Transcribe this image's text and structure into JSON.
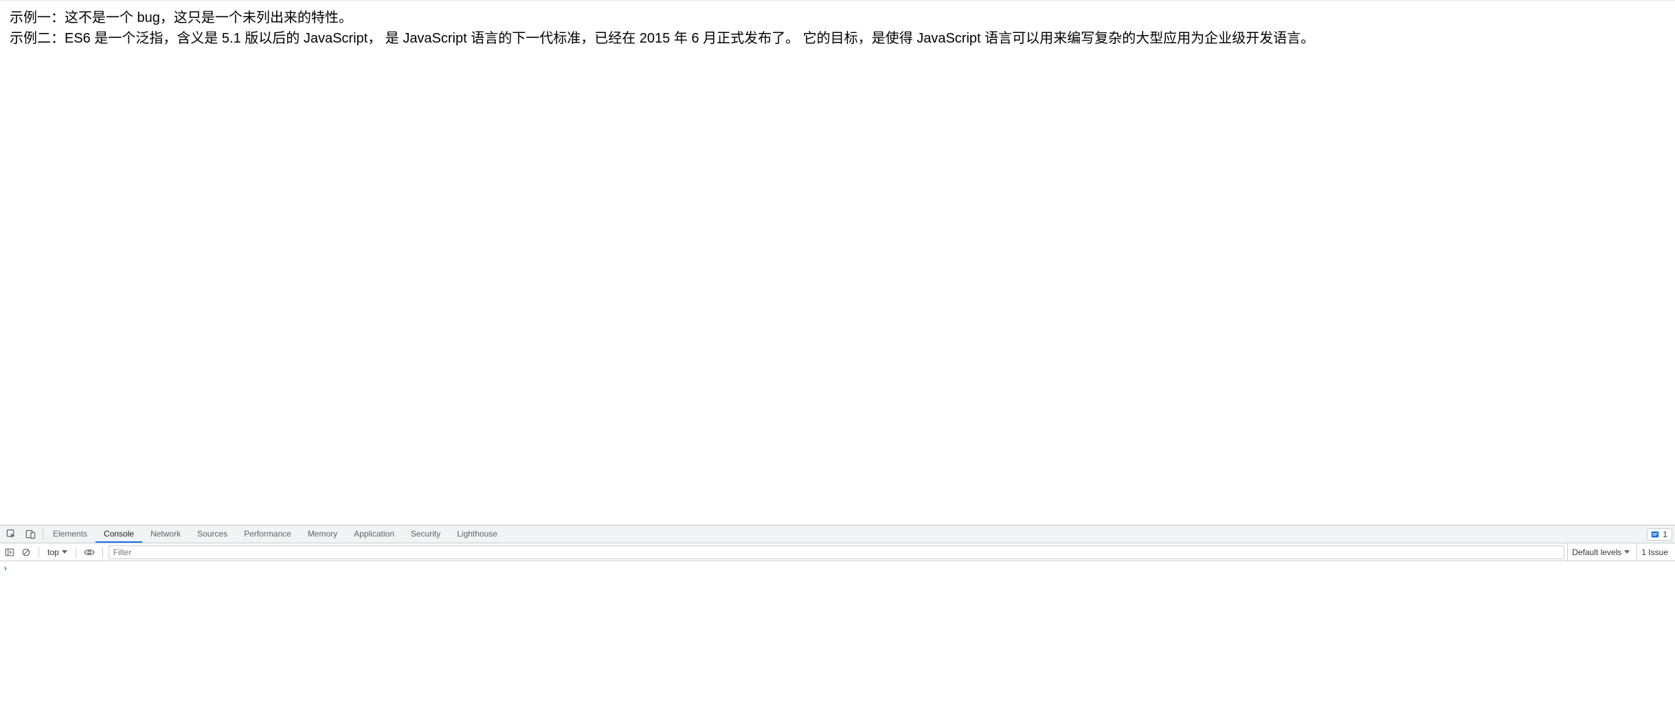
{
  "page": {
    "line1": "示例一：这不是一个 bug，这只是一个未列出来的特性。",
    "line2": "示例二：ES6 是一个泛指，含义是 5.1 版以后的 JavaScript， 是 JavaScript 语言的下一代标准，已经在 2015 年 6 月正式发布了。 它的目标，是使得 JavaScript 语言可以用来编写复杂的大型应用为企业级开发语言。"
  },
  "devtools": {
    "tabs": {
      "elements": "Elements",
      "console": "Console",
      "network": "Network",
      "sources": "Sources",
      "performance": "Performance",
      "memory": "Memory",
      "application": "Application",
      "security": "Security",
      "lighthouse": "Lighthouse"
    },
    "active_tab": "console",
    "issues_badge_count": "1",
    "toolbar": {
      "context": "top",
      "filter_placeholder": "Filter",
      "levels_label": "Default levels",
      "issues_link": "1 Issue"
    }
  }
}
